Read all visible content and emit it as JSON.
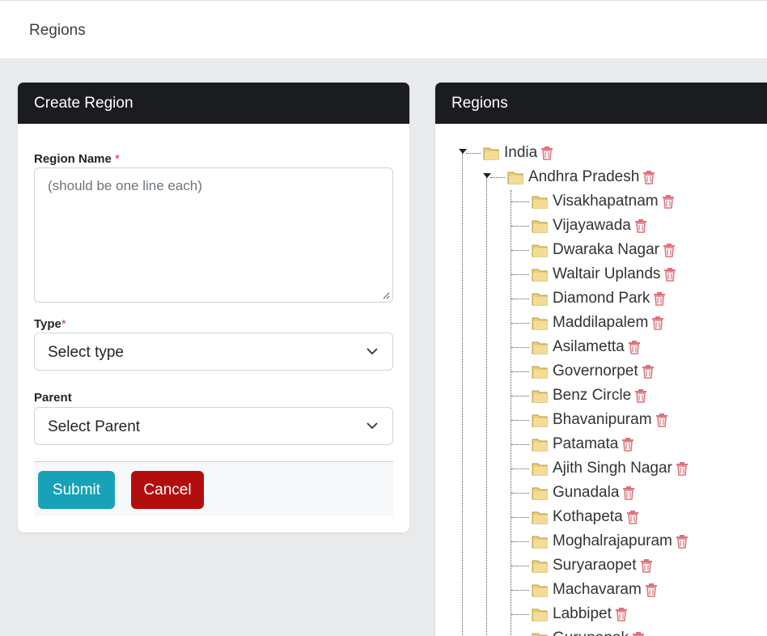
{
  "header": {
    "breadcrumb": "Regions"
  },
  "create_form": {
    "title": "Create Region",
    "region_name_label": "Region Name",
    "required_mark": "*",
    "region_name_placeholder": "(should be one line each)",
    "type_label": "Type",
    "type_value": "Select type",
    "parent_label": "Parent",
    "parent_value": "Select Parent",
    "submit_label": "Submit",
    "cancel_label": "Cancel"
  },
  "tree": {
    "title": "Regions",
    "root": "India",
    "level1": "Andhra Pradesh",
    "children": [
      "Visakhapatnam",
      "Vijayawada",
      "Dwaraka Nagar",
      "Waltair Uplands",
      "Diamond Park",
      "Maddilapalem",
      "Asilametta",
      "Governorpet",
      "Benz Circle",
      "Bhavanipuram",
      "Patamata",
      "Ajith Singh Nagar",
      "Gunadala",
      "Kothapeta",
      "Moghalrajapuram",
      "Suryaraopet",
      "Machavaram",
      "Labbipet",
      "Gurunanak"
    ]
  },
  "colors": {
    "header_bg": "#1b1c1f",
    "submit_bg": "#17a2b8",
    "cancel_bg": "#b30e0e",
    "required": "#dc3545",
    "trash": "#e0707a"
  }
}
